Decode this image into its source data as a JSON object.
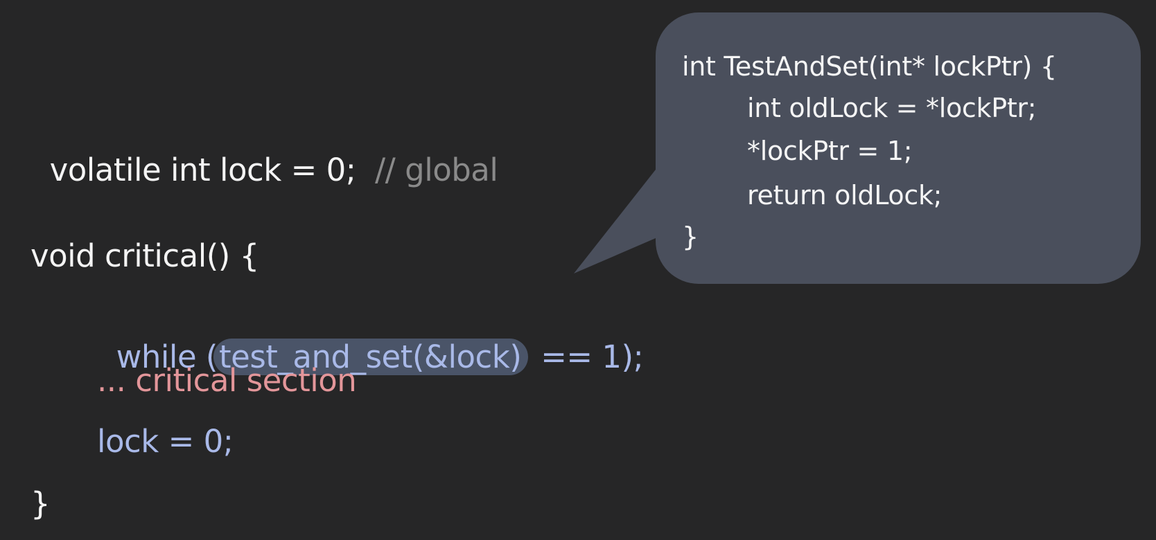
{
  "colors": {
    "background": "#262627",
    "bubble": "#4a4f5c",
    "highlight": "#4a5468",
    "code_white": "#f4f4f4",
    "code_blue": "#a9b9e8",
    "code_pink": "#e3969a",
    "comment_gray": "#8a8a8a"
  },
  "main_code": {
    "line1_code": "volatile int lock = 0;",
    "line1_comment": "// global",
    "line2": "void critical() {",
    "line3_prefix": "while (",
    "line3_highlight": "test_and_set(&lock)",
    "line3_suffix": " == 1);",
    "line4": "... critical section",
    "line5": "lock = 0;",
    "line6": "}"
  },
  "bubble_code": {
    "line1": "int TestAndSet(int* lockPtr) {",
    "line2": "int oldLock = *lockPtr;",
    "line3": "*lockPtr = 1;",
    "line4": "return oldLock;",
    "line5": "}"
  }
}
